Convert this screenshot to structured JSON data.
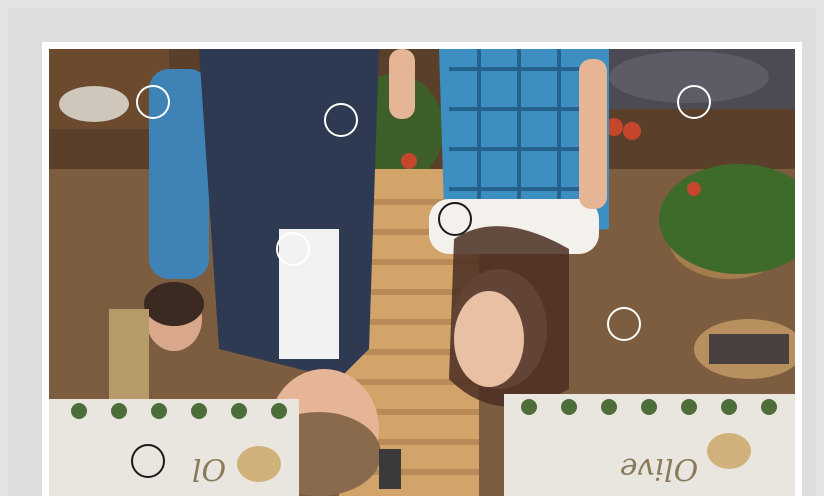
{
  "scene": {
    "image_description_icon": "market-scene-photo",
    "orientation": "upside-down",
    "sign_text": "Olive"
  },
  "markers": [
    {
      "id": "m1",
      "color": "white"
    },
    {
      "id": "m2",
      "color": "white"
    },
    {
      "id": "m3",
      "color": "white"
    },
    {
      "id": "m4",
      "color": "dark"
    },
    {
      "id": "m5",
      "color": "white"
    },
    {
      "id": "m6",
      "color": "white"
    },
    {
      "id": "m7",
      "color": "dark"
    }
  ],
  "colors": {
    "frame": "#ffffff",
    "page_bg": "#e2e3e4",
    "marker_white": "#ffffff",
    "marker_dark": "#1a1a1a"
  }
}
